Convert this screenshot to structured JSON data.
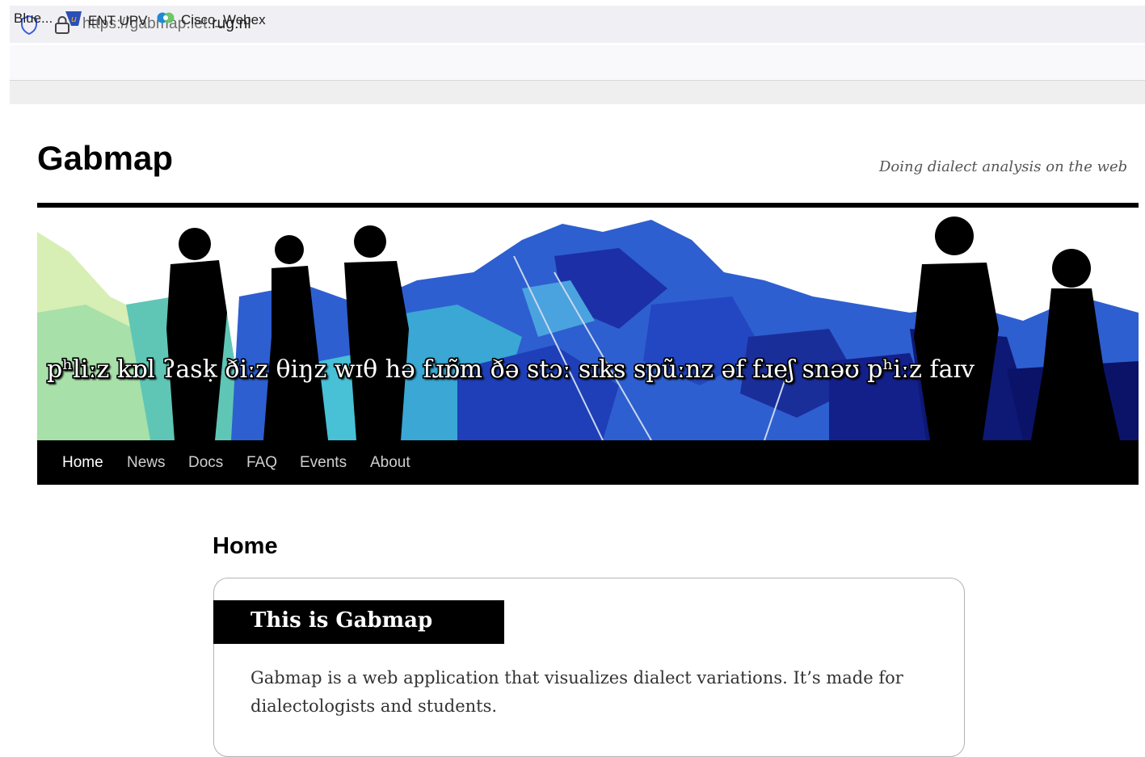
{
  "browser": {
    "url_prefix": "https://gabmap.let.",
    "url_host": "rug.nl",
    "bookmarks": [
      {
        "label": "Blue...",
        "icon": null
      },
      {
        "label": "ENT UPV",
        "icon": "ent-upv-icon"
      },
      {
        "label": "Cisco_Webex",
        "icon": "webex-icon"
      }
    ]
  },
  "site": {
    "title": "Gabmap",
    "tagline": "Doing dialect analysis on the web"
  },
  "banner": {
    "ipa_text": "pʰliːz kɒl   ʔasḳ   ðiːz θiŋz wɪθ hə fɹɒ̃m ðə stɔː sɪks spũːnz əf fɹeʃ snəʊ pʰiːz faɪv"
  },
  "nav": {
    "items": [
      "Home",
      "News",
      "Docs",
      "FAQ",
      "Events",
      "About"
    ],
    "active": "Home"
  },
  "main": {
    "heading": "Home",
    "card": {
      "title": "This is Gabmap",
      "text": "Gabmap is a web application that visualizes dialect variations. It’s made for dialectologists and students."
    }
  },
  "colors": {
    "nav_bg": "#000000",
    "map_dark_blue": "#1a2fa8",
    "map_teal": "#3fb3c8",
    "map_light": "#d9f0b8"
  }
}
